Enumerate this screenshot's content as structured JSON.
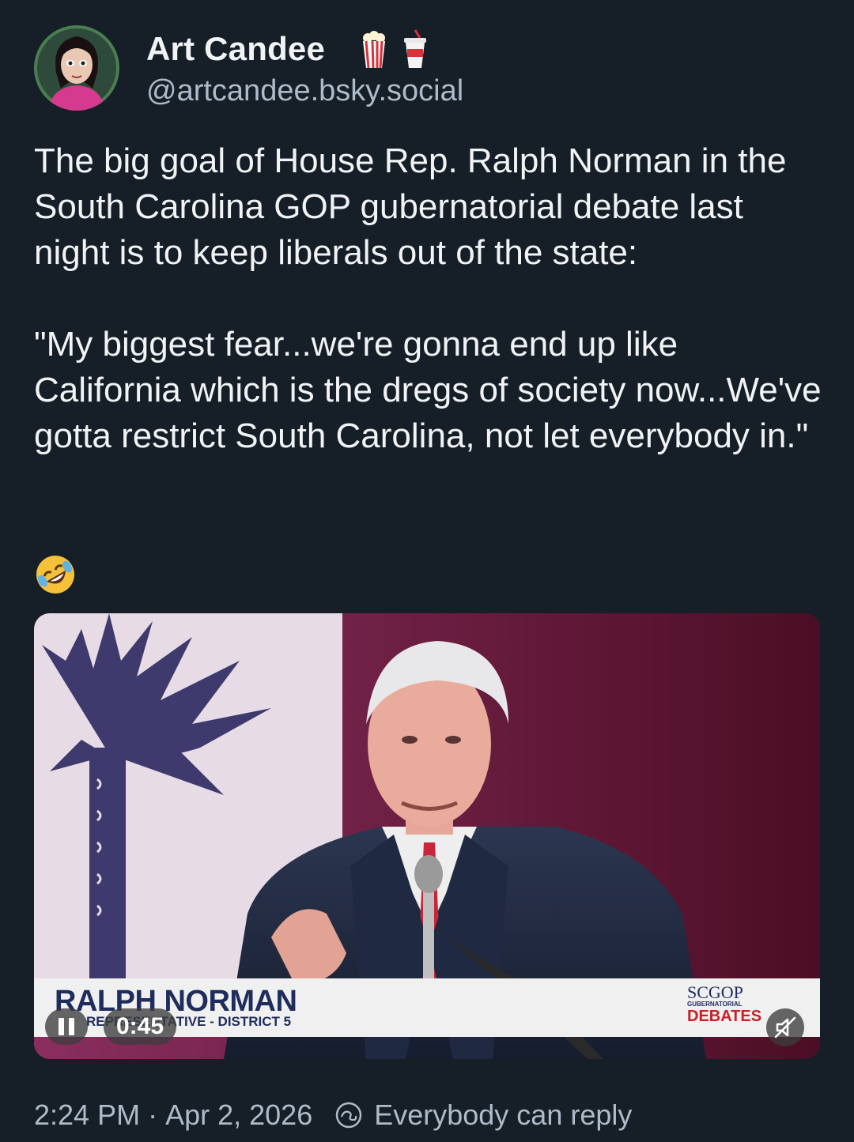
{
  "author": {
    "display_name": "Art Candee",
    "handle": "@artcandee.bsky.social",
    "name_icons": [
      "popcorn-icon",
      "soda-cup-icon"
    ]
  },
  "post": {
    "paragraph1": "The big goal of House Rep. Ralph Norman in the South Carolina GOP gubernatorial debate last night is to keep liberals out of the state:",
    "paragraph2": "\"My biggest fear...we're gonna end up like California which is the dregs of society now...We've gotta restrict South Carolina, not let everybody in.\"",
    "emoji": "rolling-on-floor-laughing-emoji"
  },
  "video": {
    "lower_third_name": "RALPH NORMAN",
    "lower_third_subtitle": "REPRESENTATIVE - DISTRICT 5",
    "logo_line1": "SCGOP",
    "logo_line2": "GUBERNATORIAL",
    "logo_line3": "DEBATES",
    "time": "0:45",
    "playing": true,
    "muted": true
  },
  "footer": {
    "time": "2:24 PM",
    "separator": "·",
    "date": "Apr 2, 2026",
    "reply_setting": "Everybody can reply"
  },
  "colors": {
    "background": "#161e27",
    "text": "#f1f3f5",
    "secondary_text": "#aebbc9"
  }
}
